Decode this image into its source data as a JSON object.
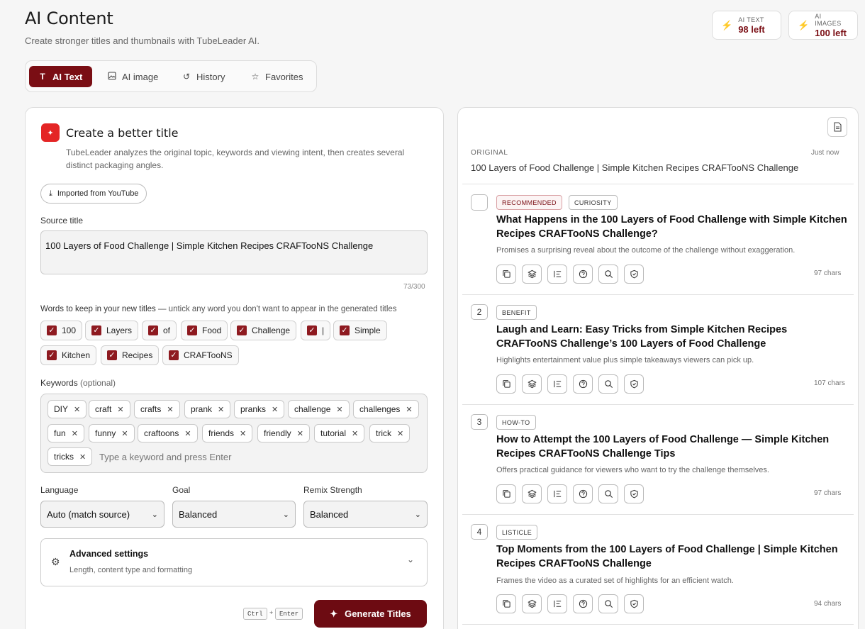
{
  "header": {
    "title": "AI Content",
    "subtitle": "Create stronger titles and thumbnails with TubeLeader AI."
  },
  "credits": [
    {
      "label": "AI TEXT",
      "value": "98 left"
    },
    {
      "label": "AI IMAGES",
      "value": "100 left"
    }
  ],
  "tabs": [
    {
      "label": "AI Text",
      "icon": "text-icon",
      "active": true
    },
    {
      "label": "AI image",
      "icon": "image-icon",
      "active": false
    },
    {
      "label": "History",
      "icon": "history-icon",
      "active": false
    },
    {
      "label": "Favorites",
      "icon": "star-icon",
      "active": false
    }
  ],
  "form": {
    "card_title": "Create a better title",
    "card_desc": "TubeLeader analyzes the original topic, keywords and viewing intent, then creates several distinct packaging angles.",
    "imported_label": "Imported from YouTube",
    "source_label": "Source title",
    "source_value": "100 Layers of Food Challenge | Simple Kitchen Recipes CRAFTooNS Challenge",
    "counter": "73/300",
    "keep_label": "Words to keep in your new titles",
    "keep_hint": " — untick any word you don't want to appear in the generated titles",
    "keep_words": [
      "100",
      "Layers",
      "of",
      "Food",
      "Challenge",
      "|",
      "Simple",
      "Kitchen",
      "Recipes",
      "CRAFTooNS"
    ],
    "keywords_label": "Keywords",
    "keywords_optional": " (optional)",
    "keywords": [
      "DIY",
      "craft",
      "crafts",
      "prank",
      "pranks",
      "challenge",
      "challenges",
      "fun",
      "funny",
      "craftoons",
      "friends",
      "friendly",
      "tutorial",
      "trick",
      "tricks"
    ],
    "keyword_placeholder": "Type a keyword and press Enter",
    "language_label": "Language",
    "language_value": "Auto (match source)",
    "goal_label": "Goal",
    "goal_value": "Balanced",
    "remix_label": "Remix Strength",
    "remix_value": "Balanced",
    "advanced_title": "Advanced settings",
    "advanced_desc": "Length, content type and formatting",
    "kbd_ctrl": "Ctrl",
    "kbd_plus": "+",
    "kbd_enter": "Enter",
    "generate_label": "Generate Titles"
  },
  "results": {
    "original_label": "ORIGINAL",
    "original_time": "Just now",
    "original_text": "100 Layers of Food Challenge | Simple Kitchen Recipes CRAFTooNS Challenge",
    "items": [
      {
        "num": "",
        "badges": [
          "RECOMMENDED",
          "CURIOSITY"
        ],
        "title": "What Happens in the 100 Layers of Food Challenge with Simple Kitchen Recipes CRAFTooNS Challenge?",
        "desc": "Promises a surprising reveal about the outcome of the challenge without exaggeration.",
        "chars": "97 chars"
      },
      {
        "num": "2",
        "badges": [
          "BENEFIT"
        ],
        "title": "Laugh and Learn: Easy Tricks from Simple Kitchen Recipes CRAFTooNS Challenge’s 100 Layers of Food Challenge",
        "desc": "Highlights entertainment value plus simple takeaways viewers can pick up.",
        "chars": "107 chars"
      },
      {
        "num": "3",
        "badges": [
          "HOW-TO"
        ],
        "title": "How to Attempt the 100 Layers of Food Challenge — Simple Kitchen Recipes CRAFTooNS Challenge Tips",
        "desc": "Offers practical guidance for viewers who want to try the challenge themselves.",
        "chars": "97 chars"
      },
      {
        "num": "4",
        "badges": [
          "LISTICLE"
        ],
        "title": "Top Moments from the 100 Layers of Food Challenge | Simple Kitchen Recipes CRAFTooNS Challenge",
        "desc": "Frames the video as a curated set of highlights for an efficient watch.",
        "chars": "94 chars"
      }
    ]
  },
  "colors": {
    "accent": "#7a0e14",
    "youtube": "#e42525"
  }
}
